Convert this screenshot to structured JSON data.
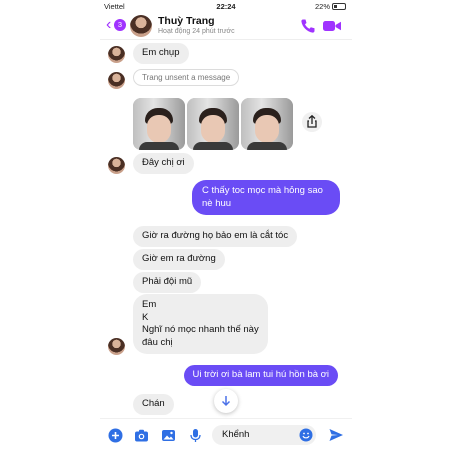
{
  "status_bar": {
    "carrier": "Viettel",
    "time": "22:24",
    "battery": "22%"
  },
  "header": {
    "back_icon": "chevron-left-icon",
    "unread_count": "3",
    "contact_name": "Thuỳ Trang",
    "activity": "Hoạt động 24 phút trước",
    "accent_color": "#a033ff"
  },
  "messages": [
    {
      "side": "in",
      "text": "Em chụp"
    },
    {
      "side": "in",
      "type": "unsent",
      "text": "Trang unsent a message"
    },
    {
      "side": "in",
      "type": "photos",
      "count": 3
    },
    {
      "side": "in",
      "text": "Đây chị ơi"
    },
    {
      "side": "out",
      "lines": [
        "C thấy toc mọc mà hỏng sao",
        "nè huu"
      ]
    },
    {
      "side": "in",
      "text": "Giờ ra đường họ bảo em là cắt tóc"
    },
    {
      "side": "in",
      "text": "Giờ em ra đường"
    },
    {
      "side": "in",
      "text": "Phải đội mũ"
    },
    {
      "side": "in",
      "lines": [
        "Em",
        "K",
        "Nghĩ nó mọc nhanh thế này",
        "đâu chị"
      ]
    },
    {
      "side": "out",
      "text": "Ui trời ơi bà lam tui hú hồn bà ơi"
    },
    {
      "side": "in",
      "text": "Chán"
    }
  ],
  "composer": {
    "value": "Khểnh",
    "send_color": "#6a4cf5"
  }
}
